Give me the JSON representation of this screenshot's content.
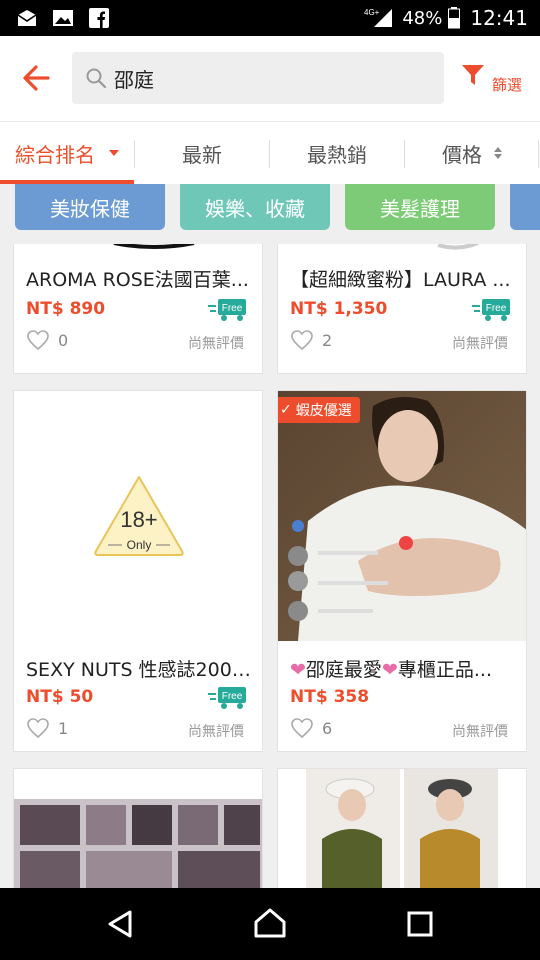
{
  "status_bar": {
    "network": "4G+",
    "battery": "48%",
    "time": "12:41",
    "icons": [
      "mail-icon",
      "image-icon",
      "facebook-icon",
      "signal-icon",
      "battery-icon"
    ]
  },
  "header": {
    "search_query": "邵庭",
    "filter_label": "篩選",
    "accent_color": "#ee4d2d"
  },
  "sort_tabs": [
    {
      "label": "綜合排名",
      "active": true
    },
    {
      "label": "最新",
      "active": false
    },
    {
      "label": "最熱銷",
      "active": false
    },
    {
      "label": "價格",
      "active": false
    }
  ],
  "categories": [
    {
      "label": "美妝保健",
      "color": "#6c9bd4"
    },
    {
      "label": "娛樂、收藏",
      "color": "#6fc7b8"
    },
    {
      "label": "美髮護理",
      "color": "#7dcb76"
    },
    {
      "label": "",
      "color": "#6c9bd4"
    }
  ],
  "products": [
    {
      "name": "AROMA ROSE法國百葉...",
      "price": "NT$ 890",
      "free_shipping": "Free",
      "likes": "0",
      "rating": "尚無評價"
    },
    {
      "name": "【超細緻蜜粉】LAURA ...",
      "price": "NT$ 1,350",
      "free_shipping": "Free",
      "likes": "2",
      "rating": "尚無評價"
    },
    {
      "name": "SEXY NUTS 性感誌2009...",
      "price": "NT$ 50",
      "free_shipping": "Free",
      "likes": "1",
      "rating": "尚無評價",
      "age_badge_big": "18+",
      "age_badge_small": "Only"
    },
    {
      "name_heart_1": "❤",
      "name_text": "邵庭最愛",
      "name_heart_2": "❤",
      "name_tail": "專櫃正品...",
      "price": "NT$ 358",
      "likes": "6",
      "rating": "尚無評價",
      "badge": "蝦皮優選"
    }
  ]
}
